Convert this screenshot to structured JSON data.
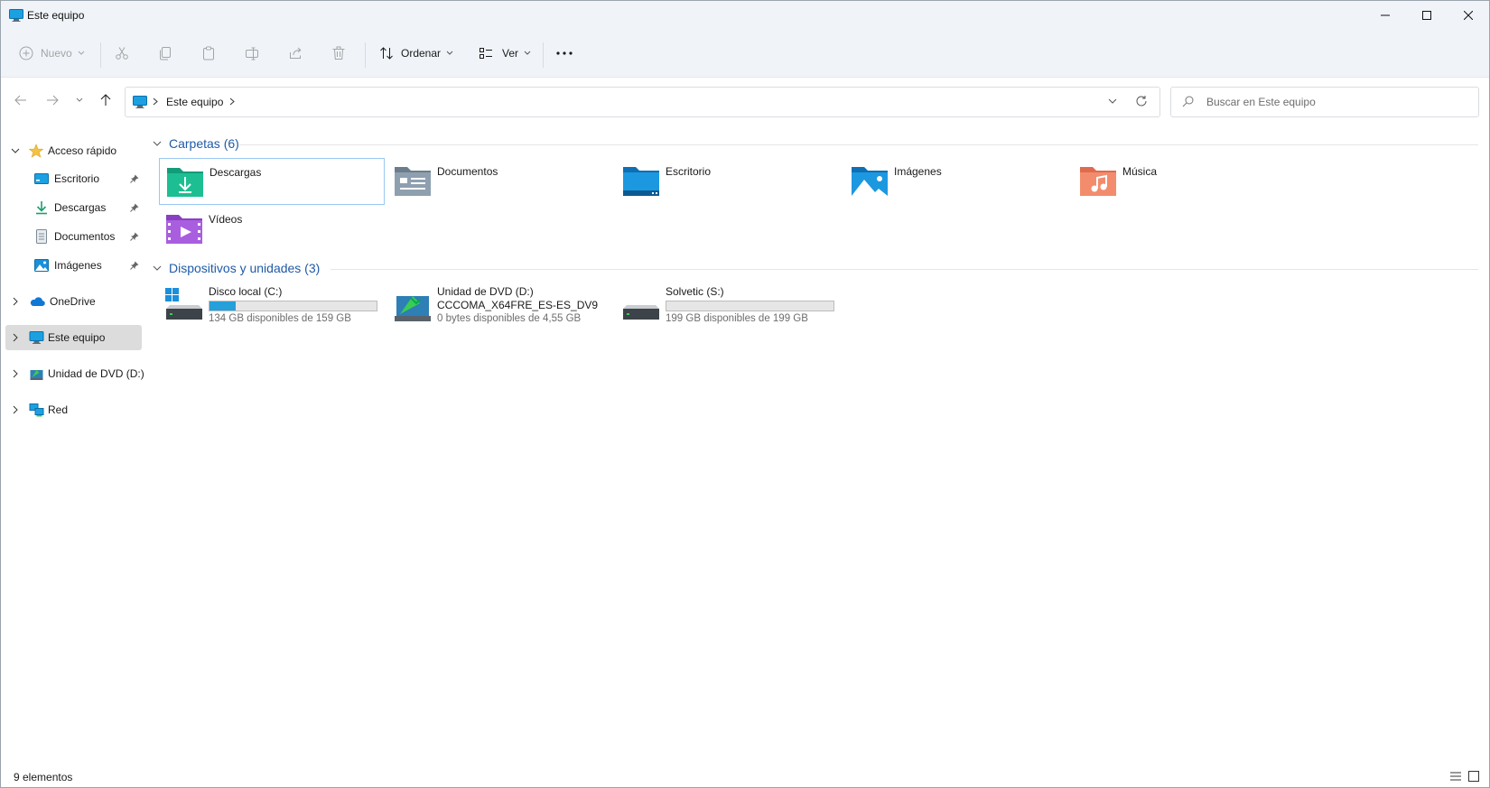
{
  "window": {
    "title": "Este equipo"
  },
  "commandbar": {
    "new_label": "Nuevo",
    "sort_label": "Ordenar",
    "view_label": "Ver"
  },
  "address": {
    "path": "Este equipo",
    "search_placeholder": "Buscar en Este equipo"
  },
  "sidebar": {
    "quick_access": "Acceso rápido",
    "quick_items": [
      {
        "label": "Escritorio",
        "icon": "desktop-icon"
      },
      {
        "label": "Descargas",
        "icon": "download-icon"
      },
      {
        "label": "Documentos",
        "icon": "documents-icon"
      },
      {
        "label": "Imágenes",
        "icon": "pictures-icon"
      }
    ],
    "onedrive": "OneDrive",
    "this_pc": "Este equipo",
    "dvd": "Unidad de DVD (D:)",
    "network": "Red"
  },
  "groups": {
    "folders_header": "Carpetas (6)",
    "devices_header": "Dispositivos y unidades (3)"
  },
  "folders": [
    {
      "label": "Descargas",
      "icon": "downloads-folder-icon"
    },
    {
      "label": "Documentos",
      "icon": "documents-folder-icon"
    },
    {
      "label": "Escritorio",
      "icon": "desktop-folder-icon"
    },
    {
      "label": "Imágenes",
      "icon": "pictures-folder-icon"
    },
    {
      "label": "Música",
      "icon": "music-folder-icon"
    },
    {
      "label": "Vídeos",
      "icon": "videos-folder-icon"
    }
  ],
  "drives": [
    {
      "name": "Disco local (C:)",
      "free": "134 GB disponibles de 159 GB",
      "used_fraction": 0.157
    },
    {
      "name": "Unidad de DVD (D:)",
      "volume": "CCCOMA_X64FRE_ES-ES_DV9",
      "free": "0 bytes disponibles de 4,55 GB"
    },
    {
      "name": "Solvetic (S:)",
      "free": "199 GB disponibles de 199 GB",
      "used_fraction": 0.0
    }
  ],
  "status": {
    "count": "9 elementos"
  },
  "colors": {
    "accent": "#1f5aa6",
    "selection": "#99c8f2",
    "bar_fill": "#26a0da"
  }
}
